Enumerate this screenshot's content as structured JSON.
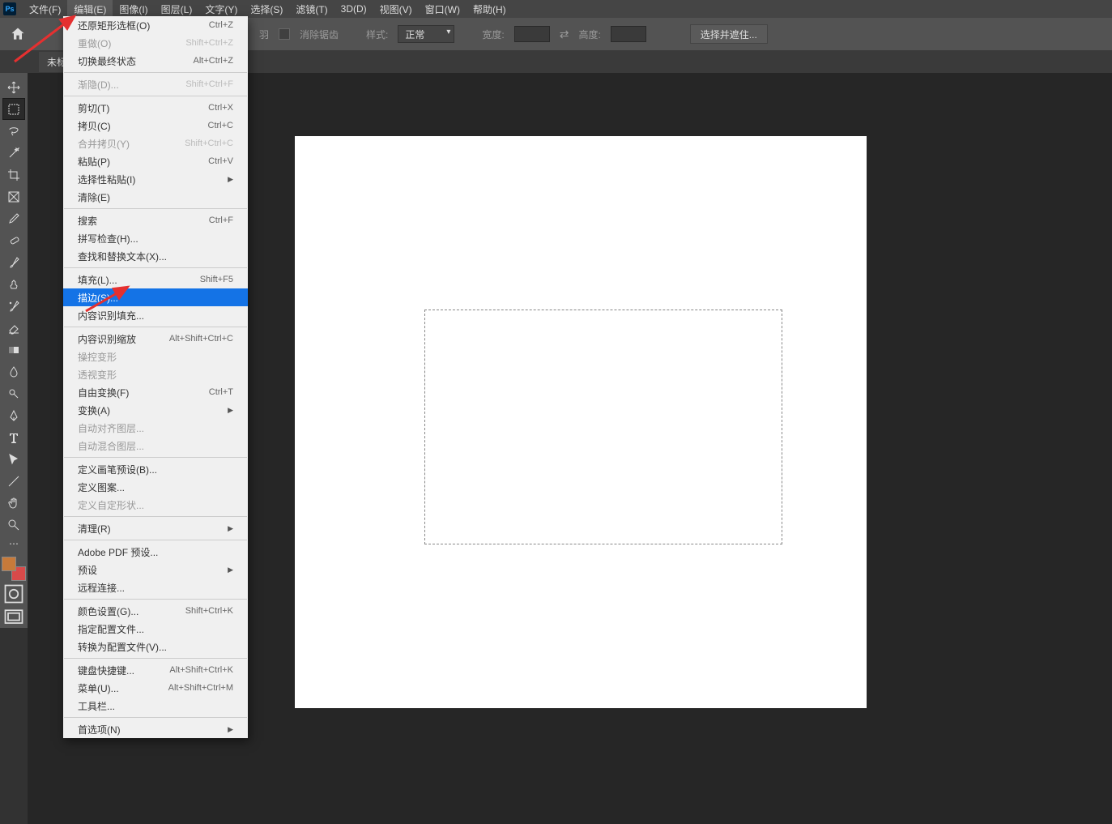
{
  "menubar": {
    "items": [
      {
        "label": "文件(F)"
      },
      {
        "label": "编辑(E)"
      },
      {
        "label": "图像(I)"
      },
      {
        "label": "图层(L)"
      },
      {
        "label": "文字(Y)"
      },
      {
        "label": "选择(S)"
      },
      {
        "label": "滤镜(T)"
      },
      {
        "label": "3D(D)"
      },
      {
        "label": "视图(V)"
      },
      {
        "label": "窗口(W)"
      },
      {
        "label": "帮助(H)"
      }
    ]
  },
  "options": {
    "feather_label": "羽",
    "anti_alias": "消除锯齿",
    "style_label": "样式:",
    "style_value": "正常",
    "width_label": "宽度:",
    "height_label": "高度:",
    "mask_button": "选择并遮住..."
  },
  "tab": {
    "title": "未标题"
  },
  "dropdown": {
    "groups": [
      [
        {
          "label": "还原矩形选框(O)",
          "shortcut": "Ctrl+Z",
          "disabled": false
        },
        {
          "label": "重做(O)",
          "shortcut": "Shift+Ctrl+Z",
          "disabled": true
        },
        {
          "label": "切换最终状态",
          "shortcut": "Alt+Ctrl+Z",
          "disabled": false
        }
      ],
      [
        {
          "label": "渐隐(D)...",
          "shortcut": "Shift+Ctrl+F",
          "disabled": true
        }
      ],
      [
        {
          "label": "剪切(T)",
          "shortcut": "Ctrl+X",
          "disabled": false
        },
        {
          "label": "拷贝(C)",
          "shortcut": "Ctrl+C",
          "disabled": false
        },
        {
          "label": "合并拷贝(Y)",
          "shortcut": "Shift+Ctrl+C",
          "disabled": true
        },
        {
          "label": "粘贴(P)",
          "shortcut": "Ctrl+V",
          "disabled": false
        },
        {
          "label": "选择性粘贴(I)",
          "shortcut": "",
          "disabled": false,
          "submenu": true
        },
        {
          "label": "清除(E)",
          "shortcut": "",
          "disabled": false
        }
      ],
      [
        {
          "label": "搜索",
          "shortcut": "Ctrl+F",
          "disabled": false
        },
        {
          "label": "拼写检查(H)...",
          "shortcut": "",
          "disabled": false
        },
        {
          "label": "查找和替换文本(X)...",
          "shortcut": "",
          "disabled": false
        }
      ],
      [
        {
          "label": "填充(L)...",
          "shortcut": "Shift+F5",
          "disabled": false
        },
        {
          "label": "描边(S)...",
          "shortcut": "",
          "disabled": false,
          "highlighted": true
        },
        {
          "label": "内容识别填充...",
          "shortcut": "",
          "disabled": false
        }
      ],
      [
        {
          "label": "内容识别缩放",
          "shortcut": "Alt+Shift+Ctrl+C",
          "disabled": false
        },
        {
          "label": "操控变形",
          "shortcut": "",
          "disabled": true
        },
        {
          "label": "透视变形",
          "shortcut": "",
          "disabled": true
        },
        {
          "label": "自由变换(F)",
          "shortcut": "Ctrl+T",
          "disabled": false
        },
        {
          "label": "变换(A)",
          "shortcut": "",
          "disabled": false,
          "submenu": true
        },
        {
          "label": "自动对齐图层...",
          "shortcut": "",
          "disabled": true
        },
        {
          "label": "自动混合图层...",
          "shortcut": "",
          "disabled": true
        }
      ],
      [
        {
          "label": "定义画笔预设(B)...",
          "shortcut": "",
          "disabled": false
        },
        {
          "label": "定义图案...",
          "shortcut": "",
          "disabled": false
        },
        {
          "label": "定义自定形状...",
          "shortcut": "",
          "disabled": true
        }
      ],
      [
        {
          "label": "清理(R)",
          "shortcut": "",
          "disabled": false,
          "submenu": true
        }
      ],
      [
        {
          "label": "Adobe PDF 预设...",
          "shortcut": "",
          "disabled": false
        },
        {
          "label": "预设",
          "shortcut": "",
          "disabled": false,
          "submenu": true
        },
        {
          "label": "远程连接...",
          "shortcut": "",
          "disabled": false
        }
      ],
      [
        {
          "label": "颜色设置(G)...",
          "shortcut": "Shift+Ctrl+K",
          "disabled": false
        },
        {
          "label": "指定配置文件...",
          "shortcut": "",
          "disabled": false
        },
        {
          "label": "转换为配置文件(V)...",
          "shortcut": "",
          "disabled": false
        }
      ],
      [
        {
          "label": "键盘快捷键...",
          "shortcut": "Alt+Shift+Ctrl+K",
          "disabled": false
        },
        {
          "label": "菜单(U)...",
          "shortcut": "Alt+Shift+Ctrl+M",
          "disabled": false
        },
        {
          "label": "工具栏...",
          "shortcut": "",
          "disabled": false
        }
      ],
      [
        {
          "label": "首选项(N)",
          "shortcut": "",
          "disabled": false,
          "submenu": true
        }
      ]
    ]
  },
  "colors": {
    "fg": "#c77a3a",
    "bg": "#d84a4a"
  },
  "tools": [
    "move",
    "marquee",
    "lasso",
    "magic-wand",
    "crop",
    "frame",
    "eyedropper",
    "healing",
    "brush",
    "clone",
    "history-brush",
    "eraser",
    "gradient",
    "blur",
    "dodge",
    "pen",
    "type",
    "path-select",
    "line",
    "hand",
    "zoom"
  ]
}
